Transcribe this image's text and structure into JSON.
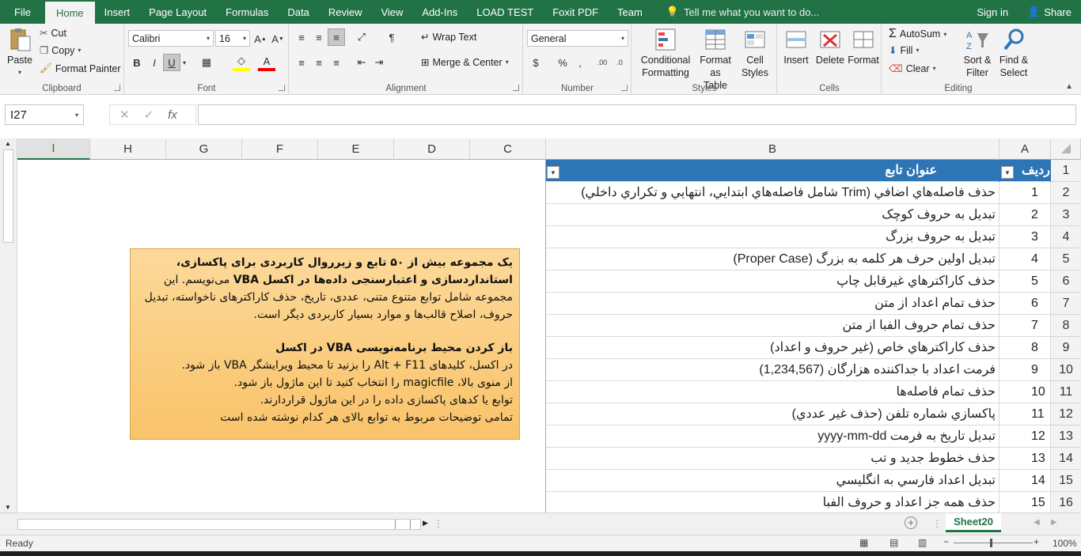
{
  "tabs": {
    "file": "File",
    "home": "Home",
    "insert": "Insert",
    "page_layout": "Page Layout",
    "formulas": "Formulas",
    "data": "Data",
    "review": "Review",
    "view": "View",
    "addins": "Add-Ins",
    "load_test": "LOAD TEST",
    "foxit": "Foxit PDF",
    "team": "Team"
  },
  "tell_me": "Tell me what you want to do...",
  "signin": "Sign in",
  "share": "Share",
  "clipboard": {
    "paste": "Paste",
    "cut": "Cut",
    "copy": "Copy",
    "format_painter": "Format Painter",
    "label": "Clipboard"
  },
  "font": {
    "name": "Calibri",
    "size": "16",
    "bold": "B",
    "italic": "I",
    "underline": "U",
    "label": "Font"
  },
  "alignment": {
    "wrap_text": "Wrap Text",
    "merge_center": "Merge & Center",
    "label": "Alignment"
  },
  "number": {
    "format": "General",
    "label": "Number"
  },
  "styles": {
    "conditional": "Conditional",
    "formatting": "Formatting",
    "format_as": "Format as",
    "table": "Table",
    "cell": "Cell",
    "styles_lbl": "Styles",
    "label": "Styles"
  },
  "cells": {
    "insert": "Insert",
    "delete": "Delete",
    "format": "Format",
    "label": "Cells"
  },
  "editing": {
    "autosum": "AutoSum",
    "fill": "Fill",
    "clear": "Clear",
    "sort": "Sort &",
    "filter": "Filter",
    "find": "Find &",
    "select": "Select",
    "label": "Editing"
  },
  "formula_bar": {
    "name_box": "I27",
    "fx": "fx",
    "value": ""
  },
  "columns": [
    "I",
    "H",
    "G",
    "F",
    "E",
    "D",
    "C",
    "B",
    "A"
  ],
  "rows": [
    {
      "num": "1",
      "a": "ردیف",
      "b": "عنوان تابع"
    },
    {
      "num": "2",
      "a": "1",
      "b": "حذف فاصله‌هاي اضافي (Trim شامل فاصله‌هاي ابتدايي، انتهايي و تكراري داخلي)"
    },
    {
      "num": "3",
      "a": "2",
      "b": "تبدیل به حروف کوچک"
    },
    {
      "num": "4",
      "a": "3",
      "b": "تبدیل به حروف بزرگ"
    },
    {
      "num": "5",
      "a": "4",
      "b": "تبدیل اولین حرف هر کلمه به بزرگ (Proper Case)"
    },
    {
      "num": "6",
      "a": "5",
      "b": "حذف كاراكترهاي غيرقابل چاپ"
    },
    {
      "num": "7",
      "a": "6",
      "b": "حذف تمام اعداد از متن"
    },
    {
      "num": "8",
      "a": "7",
      "b": "حذف تمام حروف الفبا از متن"
    },
    {
      "num": "9",
      "a": "8",
      "b": "حذف كاراكترهاي خاص (غير حروف و اعداد)"
    },
    {
      "num": "10",
      "a": "9",
      "b": "فرمت اعداد با جداكننده هزارگان (1,234,567)"
    },
    {
      "num": "11",
      "a": "10",
      "b": "حذف تمام فاصله‌ها"
    },
    {
      "num": "12",
      "a": "11",
      "b": "پاكسازي شماره تلفن (حذف غير عددي)"
    },
    {
      "num": "13",
      "a": "12",
      "b": "تبديل تاريخ به فرمت yyyy-mm-dd"
    },
    {
      "num": "14",
      "a": "13",
      "b": "حذف خطوط جديد و تب"
    },
    {
      "num": "15",
      "a": "14",
      "b": "تبديل اعداد فارسي به انگليسي"
    },
    {
      "num": "16",
      "a": "15",
      "b": "حذف همه جز اعداد و حروف الفبا"
    }
  ],
  "note": {
    "p1_bold": "یک مجموعه بیش از ۵۰ تابع و زیرروال کاربردی برای پاکسازی، استانداردسازی و اعتبارسنجی داده‌ها در اکسل VBA",
    "p1_rest": "می‌نویسم. این مجموعه شامل توابع متنوع متنی، عددی، تاریخ، حذف کاراکترهای ناخواسته، تبدیل حروف، اصلاح قالب‌ها و موارد بسیار کاربردی دیگر است.",
    "heading": "باز کردن محیط برنامه‌نویسی VBA در اکسل",
    "line1": "در اکسل، کلیدهای Alt + F11 را بزنید تا محیط ویرایشگر VBA باز شود.",
    "line2": "از منوی بالا، magicfile را انتخاب کنید تا این ماژول باز شود.",
    "line3": "توابع یا کدهای پاکسازی داده را در این ماژول قراردارند.",
    "line4": "تمامی توضیحات مربوط به توابع بالای هر کدام نوشته شده است"
  },
  "sheet_tab": "Sheet20",
  "status": {
    "ready": "Ready",
    "zoom": "100%"
  }
}
